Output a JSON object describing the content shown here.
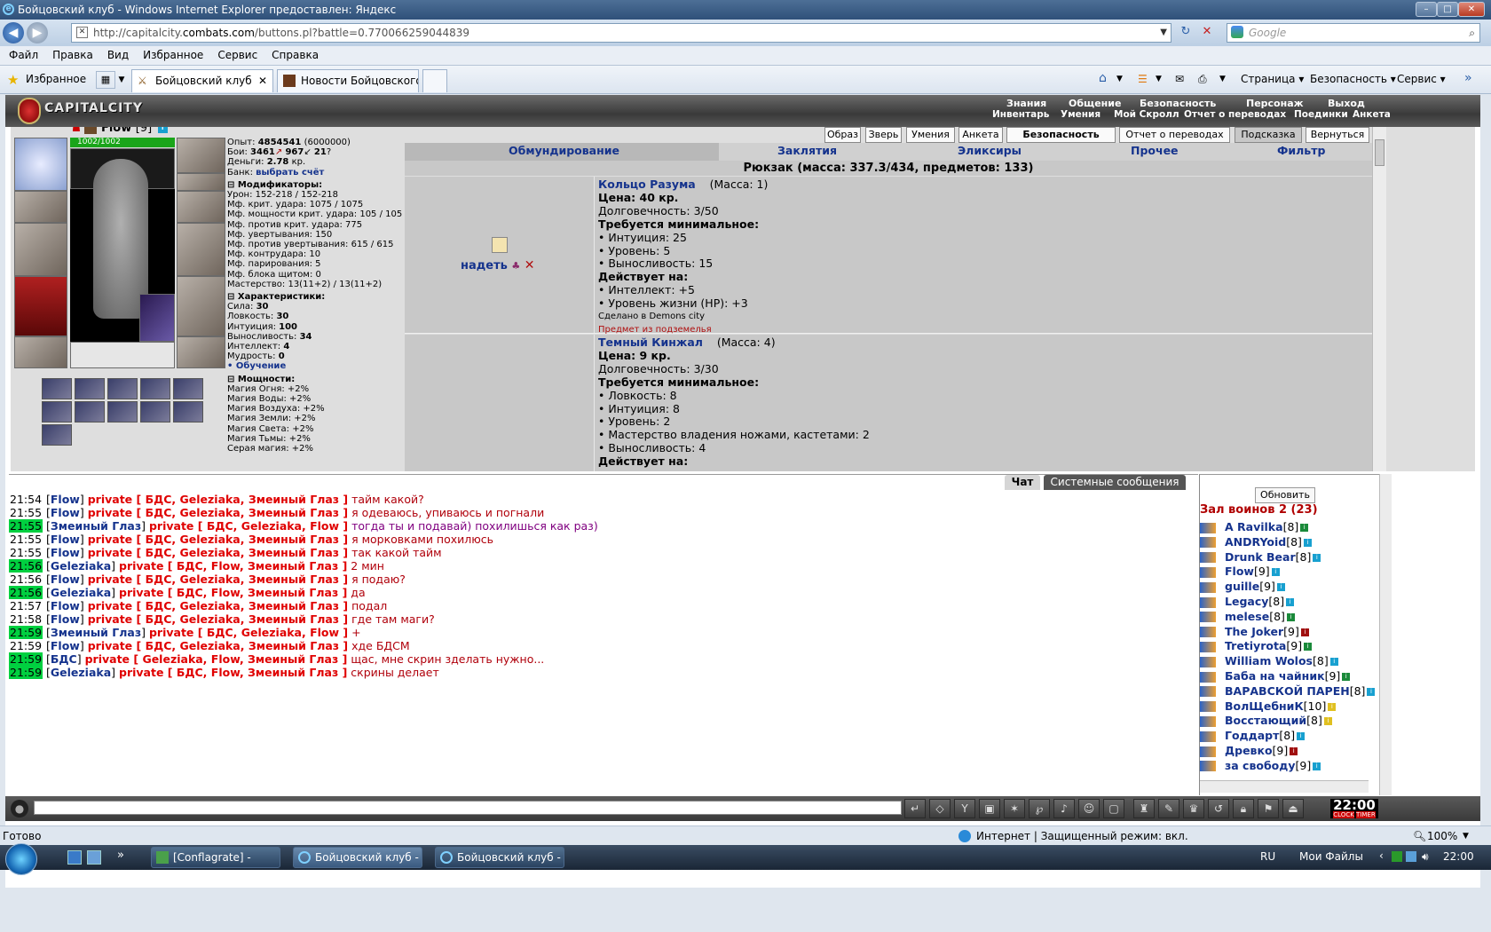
{
  "window": {
    "title": "Бойцовский клуб - Windows Internet Explorer предоставлен: Яндекс"
  },
  "nav": {
    "url_prefix": "http://capitalcity.",
    "url_domain": "combats.com",
    "url_suffix": "/buttons.pl?battle=0.770066259044839",
    "search_placeholder": "Google"
  },
  "menu": [
    "Файл",
    "Правка",
    "Вид",
    "Избранное",
    "Сервис",
    "Справка"
  ],
  "favorites_label": "Избранное",
  "tabs": [
    {
      "label": "Бойцовский клуб"
    },
    {
      "label": "Новости Бойцовского Кл..."
    }
  ],
  "commandbar": {
    "page": "Страница",
    "safety": "Безопасность",
    "tools": "Сервис"
  },
  "game": {
    "logo": "CAPITALCITY",
    "top_links": [
      "Знания",
      "Общение",
      "Безопасность",
      "Персонаж",
      "Выход"
    ],
    "sub_links": [
      "Инвентарь",
      "Умения",
      "Мой Скролл",
      "Отчет о переводах",
      "Поединки",
      "Анкета"
    ],
    "char_buttons": [
      "Образ",
      "Зверь",
      "Умения",
      "Анкета",
      "Безопасность",
      "Отчет о переводах",
      "Подсказка",
      "Вернуться"
    ],
    "inv_tabs": [
      "Обмундирование",
      "Заклятия",
      "Эликсиры",
      "Прочее",
      "Фильтр"
    ],
    "backpack": "Рюкзак (масса: 337.3/434, предметов: 133)",
    "character": {
      "nick": "Flow",
      "level": "[9]",
      "hp": "1002/1002"
    },
    "stats": {
      "exp_label": "Опыт:",
      "exp": "4854541",
      "exp_next": "(6000000)",
      "fights_label": "Бои:",
      "wins": "3461",
      "losses": "967",
      "draws": "21",
      "money_label": "Деньги:",
      "money": "2.78",
      "money_unit": "кр.",
      "bank_label": "Банк:",
      "bank_link": "выбрать счёт",
      "mods_header": "Модификаторы:",
      "mods": [
        "Урон: 152-218 / 152-218",
        "Мф. крит. удара: 1075 / 1075",
        "Мф. мощности крит. удара: 105 / 105",
        "Мф. против крит. удара: 775",
        "Мф. увертывания: 150",
        "Мф. против увертывания: 615 / 615",
        "Мф. контрудара: 10",
        "Мф. парирования: 5",
        "Мф. блока щитом: 0",
        "Мастерство: 13(11+2) / 13(11+2)"
      ],
      "chars_header": "Характеристики:",
      "chars": [
        {
          "label": "Сила:",
          "value": "30"
        },
        {
          "label": "Ловкость:",
          "value": "30"
        },
        {
          "label": "Интуиция:",
          "value": "100"
        },
        {
          "label": "Выносливость:",
          "value": "34"
        },
        {
          "label": "Интеллект:",
          "value": "4"
        },
        {
          "label": "Мудрость:",
          "value": "0"
        }
      ],
      "training": "• Обучение",
      "powers_header": "Мощности:",
      "powers": [
        "Магия Огня: +2%",
        "Магия Воды: +2%",
        "Магия Воздуха: +2%",
        "Магия Земли: +2%",
        "Магия Света: +2%",
        "Магия Тьмы: +2%",
        "Серая магия: +2%"
      ]
    },
    "items": [
      {
        "name": "Кольцо Разума",
        "mass": "(Масса: 1)",
        "price": "Цена: 40 кр.",
        "durability": "Долговечность: 3/50",
        "req_header": "Требуется минимальное:",
        "reqs": [
          "• Интуиция: 25",
          "• Уровень: 5",
          "• Выносливость: 15"
        ],
        "acts_header": "Действует на:",
        "acts": [
          "• Интеллект: +5",
          "• Уровень жизни (HP): +3"
        ],
        "made": "Сделано в Demons city",
        "note": "Предмет из подземелья",
        "wear": "надеть"
      },
      {
        "name": "Темный Кинжал",
        "mass": "(Масса: 4)",
        "price": "Цена: 9 кр.",
        "durability": "Долговечность: 3/30",
        "req_header": "Требуется минимальное:",
        "reqs": [
          "• Ловкость: 8",
          "• Интуиция: 8",
          "• Уровень: 2",
          "• Мастерство владения ножами, кастетами: 2",
          "• Выносливость: 4"
        ],
        "acts_header": "Действует на:"
      }
    ]
  },
  "chat": {
    "tabs": [
      "Чат",
      "Системные сообщения"
    ],
    "messages": [
      {
        "time": "21:54",
        "hl": false,
        "nick": "Flow",
        "to": "private [ БДС, Geleziaka, Змеиный Глаз ]",
        "text": "тайм какой?"
      },
      {
        "time": "21:55",
        "hl": false,
        "nick": "Flow",
        "to": "private [ БДС, Geleziaka, Змеиный Глаз ]",
        "text": "я одеваюсь, упиваюсь и погнали"
      },
      {
        "time": "21:55",
        "hl": true,
        "nick": "Змеиный Глаз",
        "to": "private [ БДС, Geleziaka, Flow ]",
        "text": "тогда ты и подавай) похилишься как раз)",
        "pur": true
      },
      {
        "time": "21:55",
        "hl": false,
        "nick": "Flow",
        "to": "private [ БДС, Geleziaka, Змеиный Глаз ]",
        "text": "я морковками похилюсь"
      },
      {
        "time": "21:55",
        "hl": false,
        "nick": "Flow",
        "to": "private [ БДС, Geleziaka, Змеиный Глаз ]",
        "text": "так какой тайм"
      },
      {
        "time": "21:56",
        "hl": true,
        "nick": "Geleziaka",
        "to": "private [ БДС, Flow, Змеиный Глаз ]",
        "text": "2 мин"
      },
      {
        "time": "21:56",
        "hl": false,
        "nick": "Flow",
        "to": "private [ БДС, Geleziaka, Змеиный Глаз ]",
        "text": "я подаю?"
      },
      {
        "time": "21:56",
        "hl": true,
        "nick": "Geleziaka",
        "to": "private [ БДС, Flow, Змеиный Глаз ]",
        "text": "да"
      },
      {
        "time": "21:57",
        "hl": false,
        "nick": "Flow",
        "to": "private [ БДС, Geleziaka, Змеиный Глаз ]",
        "text": "подал"
      },
      {
        "time": "21:58",
        "hl": false,
        "nick": "Flow",
        "to": "private [ БДС, Geleziaka, Змеиный Глаз ]",
        "text": "где там маги?"
      },
      {
        "time": "21:59",
        "hl": true,
        "nick": "Змеиный Глаз",
        "to": "private [ БДС, Geleziaka, Flow ]",
        "text": "+"
      },
      {
        "time": "21:59",
        "hl": false,
        "nick": "Flow",
        "to": "private [ БДС, Geleziaka, Змеиный Глаз ]",
        "text": "хде БДСМ"
      },
      {
        "time": "21:59",
        "hl": true,
        "nick": "БДС",
        "to": "private [ Geleziaka, Flow, Змеиный Глаз ]",
        "text": "щас, мне скрин зделать нужно..."
      },
      {
        "time": "21:59",
        "hl": true,
        "nick": "Geleziaka",
        "to": "private [ БДС, Flow, Змеиный Глаз ]",
        "text": "скрины делает"
      }
    ]
  },
  "online": {
    "refresh": "Обновить",
    "hall": "Зал воинов 2 (23)",
    "users": [
      {
        "name": "A Ravilka",
        "lvl": "[8]",
        "info": "green"
      },
      {
        "name": "ANDRYoid",
        "lvl": "[8]",
        "info": "blue"
      },
      {
        "name": "Drunk Bear",
        "lvl": "[8]",
        "info": "blue"
      },
      {
        "name": "Flow",
        "lvl": "[9]",
        "info": "blue"
      },
      {
        "name": "guille",
        "lvl": "[9]",
        "info": "blue"
      },
      {
        "name": "Legacy",
        "lvl": "[8]",
        "info": "blue"
      },
      {
        "name": "melese",
        "lvl": "[8]",
        "info": "green"
      },
      {
        "name": "The Joker",
        "lvl": "[9]",
        "info": "red"
      },
      {
        "name": "Tretiyrota",
        "lvl": "[9]",
        "info": "green"
      },
      {
        "name": "William Wolos",
        "lvl": "[8]",
        "info": "blue"
      },
      {
        "name": "Баба на чайник",
        "lvl": "[9]",
        "info": "green"
      },
      {
        "name": "ВАРАВСКОЙ ПАРЕН",
        "lvl": "[8]",
        "info": "blue"
      },
      {
        "name": "ВолЩебниК",
        "lvl": "[10]",
        "info": "yel"
      },
      {
        "name": "Восстающий",
        "lvl": "[8]",
        "info": "yel"
      },
      {
        "name": "Годдарт",
        "lvl": "[8]",
        "info": "blue"
      },
      {
        "name": "Древко",
        "lvl": "[9]",
        "info": "red"
      },
      {
        "name": "за свободу",
        "lvl": "[9]",
        "info": "blue"
      }
    ]
  },
  "clock": {
    "time": "22:00",
    "label1": "CLOCK",
    "label2": "TIMER"
  },
  "status": {
    "ready": "Готово",
    "zone": "Интернет | Защищенный режим: вкл.",
    "zoom": "100%"
  },
  "taskbar": {
    "buttons": [
      "[Conflagrate] - Окн...",
      "Бойцовский клуб - ...",
      "Бойцовский клуб - ..."
    ],
    "lang": "RU",
    "myfiles": "Мои Файлы",
    "time": "22:00"
  }
}
